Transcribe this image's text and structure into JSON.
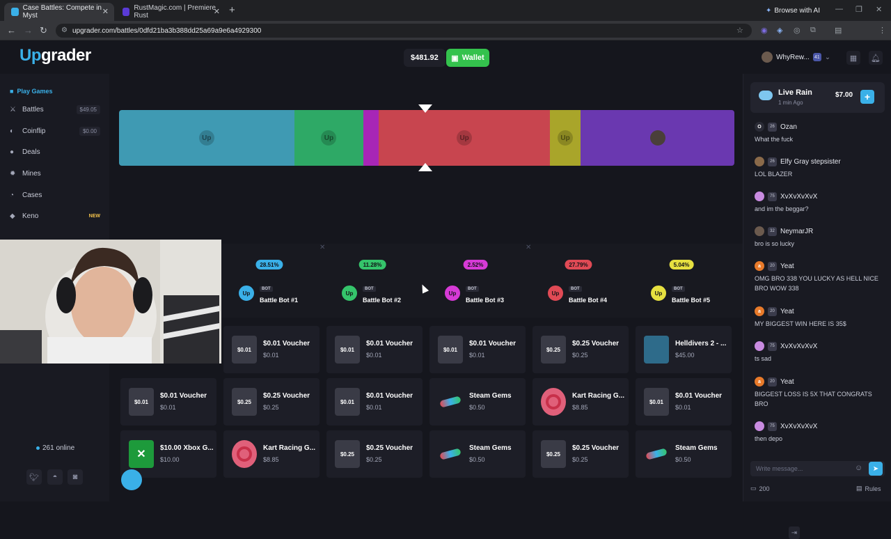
{
  "browser": {
    "tabs": [
      {
        "title": "Case Battles: Compete in Myst",
        "active": true,
        "favicon_color": "#3ab0e8"
      },
      {
        "title": "RustMagic.com | Premiere Rust",
        "active": false,
        "favicon_color": "#5a3bd6"
      }
    ],
    "browse_ai": "Browse with AI",
    "url": "upgrader.com/battles/0dfd21ba3b388dd25a69a9e6a4929300"
  },
  "header": {
    "logo_up": "Up",
    "logo_rest": "grader",
    "balance": "$481.92",
    "wallet": "Wallet",
    "username": "WhyRew...",
    "user_level": "41"
  },
  "sidebar": {
    "title": "Play Games",
    "items": [
      {
        "label": "Battles",
        "value": "$49.05",
        "icon": "swords-icon"
      },
      {
        "label": "Coinflip",
        "value": "$0.00",
        "icon": "coin-icon"
      },
      {
        "label": "Deals",
        "value": "",
        "icon": "deals-icon"
      },
      {
        "label": "Mines",
        "value": "",
        "icon": "mine-icon"
      },
      {
        "label": "Cases",
        "value": "",
        "icon": "case-icon"
      },
      {
        "label": "Keno",
        "value": "",
        "icon": "keno-icon",
        "badge": "NEW"
      }
    ],
    "online": "261 online"
  },
  "spinner": {
    "segments": [
      {
        "color": "#3f9ab3",
        "share": 28.51,
        "label": "Up"
      },
      {
        "color": "#2ea966",
        "share": 11.28,
        "label": "Up"
      },
      {
        "color": "#a726b6",
        "share": 2.52,
        "label": ""
      },
      {
        "color": "#c8454f",
        "share": 27.79,
        "label": "Up"
      },
      {
        "color": "#a9a52a",
        "share": 5.04,
        "label": "Up"
      },
      {
        "color": "#6a38b0",
        "share": 25.0,
        "label": ""
      }
    ]
  },
  "players": [
    {
      "pct": "28.51%",
      "name": "Battle Bot #1",
      "bot": "BOT",
      "color": "#3ab0e8"
    },
    {
      "pct": "11.28%",
      "name": "Battle Bot #2",
      "bot": "BOT",
      "color": "#35c46b"
    },
    {
      "pct": "2.52%",
      "name": "Battle Bot #3",
      "bot": "BOT",
      "color": "#d63ad6"
    },
    {
      "pct": "27.79%",
      "name": "Battle Bot #4",
      "bot": "BOT",
      "color": "#e04a55"
    },
    {
      "pct": "5.04%",
      "name": "Battle Bot #5",
      "bot": "BOT",
      "color": "#e6e040"
    }
  ],
  "items": [
    [
      {
        "name": "$0.01 Voucher",
        "price": "$0.01",
        "thumb": "$0.01",
        "kind": "voucher"
      },
      {
        "name": "$0.01 Voucher",
        "price": "$0.01",
        "thumb": "$0.01",
        "kind": "voucher"
      },
      {
        "name": "$0.01 Voucher",
        "price": "$0.01",
        "thumb": "$0.01",
        "kind": "voucher"
      },
      {
        "name": "$0.25 Voucher",
        "price": "$0.25",
        "thumb": "$0.25",
        "kind": "voucher"
      },
      {
        "name": "Helldivers 2 - ...",
        "price": "$45.00",
        "thumb": "",
        "kind": "game"
      }
    ],
    [
      {
        "name": "$0.01 Voucher",
        "price": "$0.01",
        "thumb": "$0.01",
        "kind": "voucher"
      },
      {
        "name": "$0.25 Voucher",
        "price": "$0.25",
        "thumb": "$0.25",
        "kind": "voucher"
      },
      {
        "name": "$0.01 Voucher",
        "price": "$0.01",
        "thumb": "$0.01",
        "kind": "voucher"
      },
      {
        "name": "Steam Gems",
        "price": "$0.50",
        "thumb": "",
        "kind": "gems"
      },
      {
        "name": "Kart Racing G...",
        "price": "$8.85",
        "thumb": "",
        "kind": "wheel"
      },
      {
        "name": "$0.01 Voucher",
        "price": "$0.01",
        "thumb": "$0.01",
        "kind": "voucher"
      }
    ],
    [
      {
        "name": "$10.00 Xbox G...",
        "price": "$10.00",
        "thumb": "",
        "kind": "xbox"
      },
      {
        "name": "Kart Racing G...",
        "price": "$8.85",
        "thumb": "",
        "kind": "wheel"
      },
      {
        "name": "$0.25 Voucher",
        "price": "$0.25",
        "thumb": "$0.25",
        "kind": "voucher"
      },
      {
        "name": "Steam Gems",
        "price": "$0.50",
        "thumb": "",
        "kind": "gems"
      },
      {
        "name": "$0.25 Voucher",
        "price": "$0.25",
        "thumb": "$0.25",
        "kind": "voucher"
      },
      {
        "name": "Steam Gems",
        "price": "$0.50",
        "thumb": "",
        "kind": "gems"
      }
    ]
  ],
  "chat": {
    "rain_title": "Live Rain",
    "rain_time": "1 min Ago",
    "rain_amount": "$7.00",
    "messages": [
      {
        "level": "26",
        "name": "Ozan",
        "text": "What the fuck",
        "av": "O",
        "av_color": "#2a2b36"
      },
      {
        "level": "26",
        "name": "Elfy Gray stepsister",
        "text": "LOL BLAZER",
        "av": "",
        "av_color": "#8a6a4a"
      },
      {
        "level": "75",
        "name": "XvXvXvXvX",
        "text": "and im the beggar?",
        "av": "",
        "av_color": "#c88be0"
      },
      {
        "level": "32",
        "name": "NeymarJR",
        "text": "bro is so lucky",
        "av": "",
        "av_color": "#6b5a4e"
      },
      {
        "level": "20",
        "name": "Yeat",
        "text": "OMG BRO 338 YOU LUCKY AS HELL NICE BRO WOW 338",
        "av": "a",
        "av_color": "#e87a2a"
      },
      {
        "level": "20",
        "name": "Yeat",
        "text": "MY BIGGEST WIN HERE IS 35$",
        "av": "a",
        "av_color": "#e87a2a"
      },
      {
        "level": "75",
        "name": "XvXvXvXvX",
        "text": "ts sad",
        "av": "",
        "av_color": "#c88be0"
      },
      {
        "level": "20",
        "name": "Yeat",
        "text": "BIGGEST LOSS IS 5X THAT CONGRATS BRO",
        "av": "a",
        "av_color": "#e87a2a"
      },
      {
        "level": "75",
        "name": "XvXvXvXvX",
        "text": "then depo",
        "av": "",
        "av_color": "#c88be0"
      }
    ],
    "input_placeholder": "Write message...",
    "online_count": "200",
    "rules": "Rules"
  }
}
